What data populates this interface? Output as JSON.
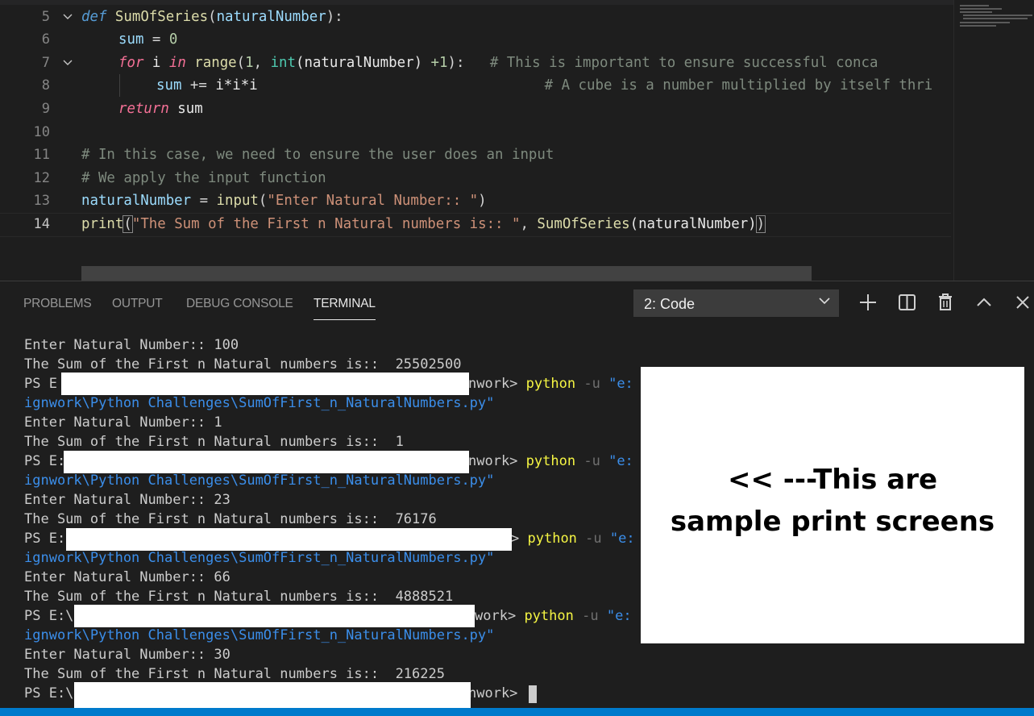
{
  "editor": {
    "lines": [
      {
        "n": "5",
        "fold": true
      },
      {
        "n": "6"
      },
      {
        "n": "7",
        "fold": true
      },
      {
        "n": "8"
      },
      {
        "n": "9"
      },
      {
        "n": "10"
      },
      {
        "n": "11"
      },
      {
        "n": "12"
      },
      {
        "n": "13"
      },
      {
        "n": "14",
        "active": true
      }
    ],
    "tokens": {
      "l5": [
        "def",
        "SumOfSeries",
        "(",
        "naturalNumber",
        "):"
      ],
      "l6": [
        "sum",
        " = ",
        "0"
      ],
      "l7": [
        "for",
        " i ",
        "in",
        " ",
        "range",
        "(",
        "1",
        ", ",
        "int",
        "(naturalNumber) ",
        "+1",
        "):",
        "   # This is important to ensure successful conca"
      ],
      "l8": [
        "sum",
        " += ",
        "i*i*i",
        "                                  # A cube is a number multiplied by itself thri"
      ],
      "l9": [
        "return",
        " sum"
      ],
      "l11": "# In this case, we need to ensure the user does an input",
      "l12": "# We apply the input function",
      "l13": [
        "naturalNumber",
        " = ",
        "input",
        "(",
        "\"Enter Natural Number:: \"",
        ")"
      ],
      "l14": [
        "print",
        "(",
        "\"The Sum of the First n Natural numbers is:: \"",
        ", ",
        "SumOfSeries",
        "(naturalNumber)",
        ")"
      ]
    }
  },
  "panel": {
    "tabs": [
      "PROBLEMS",
      "OUTPUT",
      "DEBUG CONSOLE",
      "TERMINAL"
    ],
    "active_tab": "TERMINAL",
    "terminal_select": "2: Code"
  },
  "terminal": {
    "lines": [
      "Enter Natural Number:: 100",
      "The Sum of the First n Natural numbers is::  25502500",
      {
        "ps": "PS E",
        "tail": "nwork>",
        "cmd": "python",
        "flag": "-u",
        "q": "\"e:"
      },
      "ignwork\\Python Challenges\\SumOfFirst_n_NaturalNumbers.py\"",
      "Enter Natural Number:: 1",
      "The Sum of the First n Natural numbers is::  1",
      {
        "ps": "PS E:",
        "tail": "nwork>",
        "cmd": "python",
        "flag": "-u",
        "q": "\"e:"
      },
      "ignwork\\Python Challenges\\SumOfFirst_n_NaturalNumbers.py\"",
      "Enter Natural Number:: 23",
      "The Sum of the First n Natural numbers is::  76176",
      {
        "ps": "PS E:",
        "tail": ">",
        "cmd": "python",
        "flag": "-u",
        "q": "\"e:"
      },
      "ignwork\\Python Challenges\\SumOfFirst_n_NaturalNumbers.py\"",
      "Enter Natural Number:: 66",
      "The Sum of the First n Natural numbers is::  4888521",
      {
        "ps": "PS E:\\",
        "tail": "work>",
        "cmd": "python",
        "flag": "-u",
        "q": "\"e:"
      },
      "ignwork\\Python Challenges\\SumOfFirst_n_NaturalNumbers.py\"",
      "Enter Natural Number:: 30",
      "The Sum of the First n Natural numbers is::  216225",
      {
        "ps": "PS E:\\",
        "tail": "nwork>"
      }
    ]
  },
  "note": {
    "line1": "<< ---This are",
    "line2": "sample print screens"
  }
}
